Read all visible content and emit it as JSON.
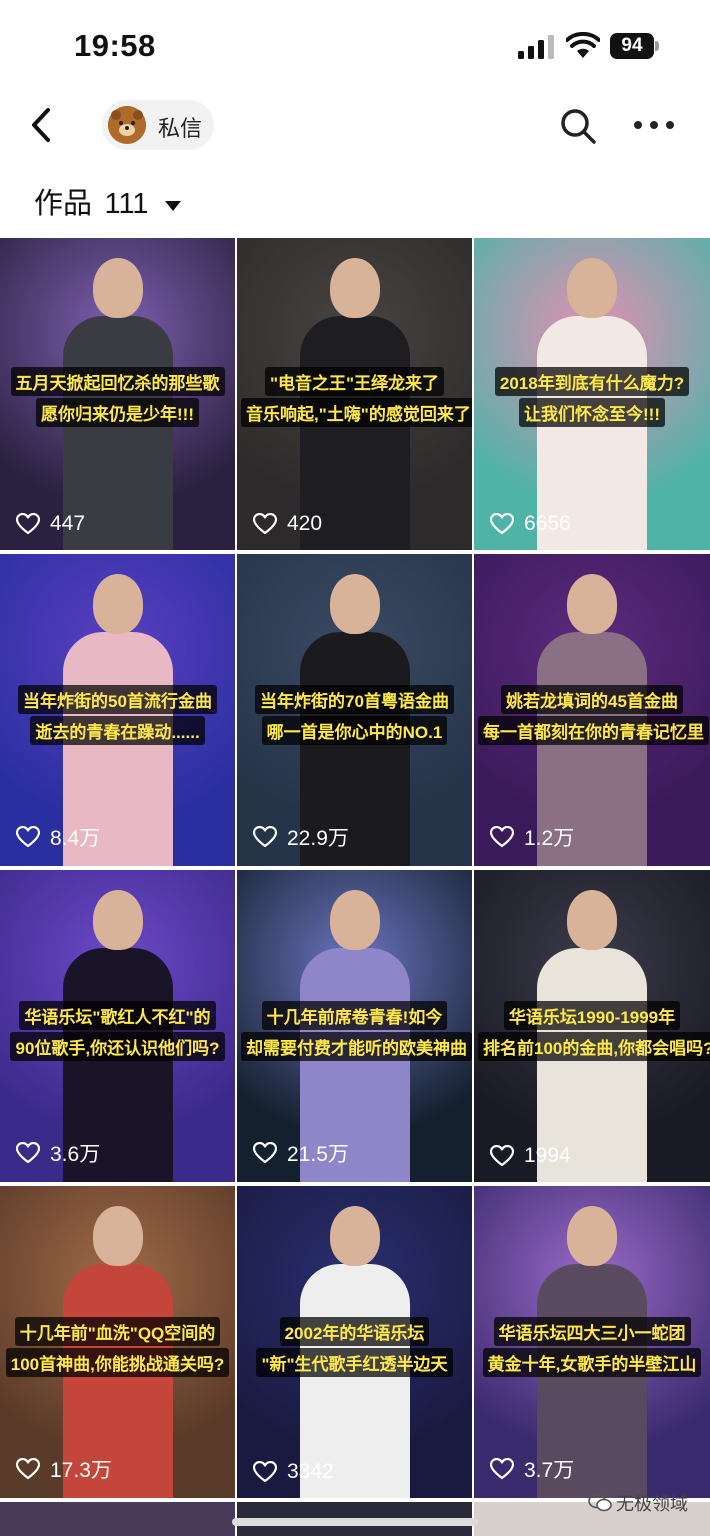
{
  "status": {
    "time": "19:58",
    "battery": "94"
  },
  "nav": {
    "dm_label": "私信"
  },
  "works": {
    "label": "作品",
    "count": "111"
  },
  "tiles": [
    {
      "caption": [
        "五月天掀起回忆杀的那些歌",
        "愿你归来仍是少年!!!"
      ],
      "likes": "447",
      "bg": "#2a2140",
      "accent": "#7e5fb0",
      "body": "#3b3b44"
    },
    {
      "caption": [
        "\"电音之王\"王绎龙来了",
        "音乐响起,\"土嗨\"的感觉回来了"
      ],
      "likes": "420",
      "bg": "#2c2a2a",
      "accent": "#4a4444",
      "body": "#1e1e22"
    },
    {
      "caption": [
        "2018年到底有什么魔力?",
        "让我们怀念至今!!!"
      ],
      "likes": "6656",
      "bg": "#4fb3a8",
      "accent": "#e38fb2",
      "body": "#f2e8e4"
    },
    {
      "caption": [
        "当年炸街的50首流行金曲",
        "逝去的青春在躁动......"
      ],
      "likes": "8.4万",
      "bg": "#2a2fa0",
      "accent": "#5a3fc0",
      "body": "#e8b9c4"
    },
    {
      "caption": [
        "当年炸街的70首粤语金曲",
        "哪一首是你心中的NO.1"
      ],
      "likes": "22.9万",
      "bg": "#26344a",
      "accent": "#3b4a63",
      "body": "#1b1b1f"
    },
    {
      "caption": [
        "姚若龙填词的45首金曲",
        "每一首都刻在你的青春记忆里"
      ],
      "likes": "1.2万",
      "bg": "#3a1a5a",
      "accent": "#5d2a7e",
      "body": "#8a6f85"
    },
    {
      "caption": [
        "华语乐坛\"歌红人不红\"的",
        "90位歌手,你还认识他们吗?"
      ],
      "likes": "3.6万",
      "bg": "#3a2a8a",
      "accent": "#6e48c8",
      "body": "#1a1428"
    },
    {
      "caption": [
        "十几年前席卷青春!如今",
        "却需要付费才能听的欧美神曲"
      ],
      "likes": "21.5万",
      "bg": "#15202e",
      "accent": "#6b74c0",
      "body": "#8f86c9"
    },
    {
      "caption": [
        "华语乐坛1990-1999年",
        "排名前100的金曲,你都会唱吗?"
      ],
      "likes": "1994",
      "bg": "#1a1a24",
      "accent": "#3a3a4a",
      "body": "#e8e4dc"
    },
    {
      "caption": [
        "十几年前\"血洗\"QQ空间的",
        "100首神曲,你能挑战通关吗?"
      ],
      "likes": "17.3万",
      "bg": "#5a3a28",
      "accent": "#a06a48",
      "body": "#c4463a"
    },
    {
      "caption": [
        "2002年的华语乐坛",
        "\"新\"生代歌手红透半边天"
      ],
      "likes": "3342",
      "bg": "#1a1a40",
      "accent": "#2a2f70",
      "body": "#eeeeee"
    },
    {
      "caption": [
        "华语乐坛四大三小一蛇团",
        "黄金十年,女歌手的半壁江山"
      ],
      "likes": "3.7万",
      "bg": "#3a2a6e",
      "accent": "#9a6ac8",
      "body": "#5a4a60"
    }
  ],
  "watermark": "无极领域"
}
